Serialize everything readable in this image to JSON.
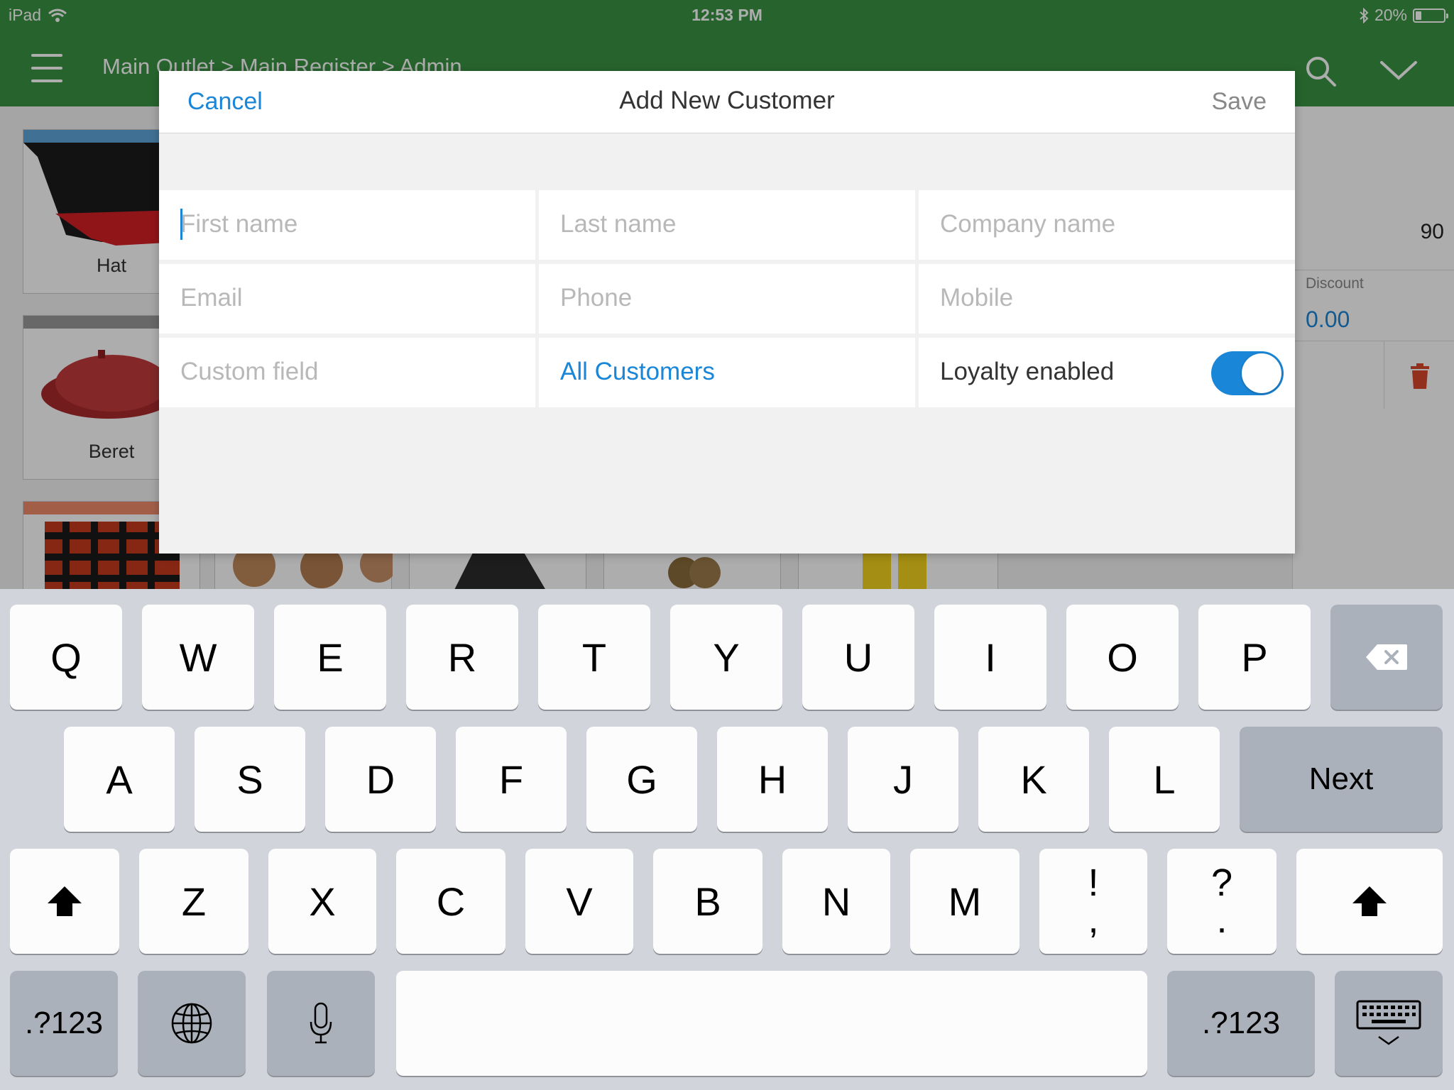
{
  "status_bar": {
    "device": "iPad",
    "time": "12:53 PM",
    "battery": "20%",
    "battery_fraction": 0.2
  },
  "app_bar": {
    "breadcrumb": "Main Outlet > Main Register > Admin"
  },
  "products": [
    "Hat",
    "Beret"
  ],
  "sale_panel": {
    "value": "90",
    "discount_label": "Discount",
    "discount_value": "0.00"
  },
  "modal": {
    "title": "Add New Customer",
    "cancel_label": "Cancel",
    "save_label": "Save",
    "fields": {
      "first_name": "First name",
      "last_name": "Last name",
      "company_name": "Company name",
      "email": "Email",
      "phone": "Phone",
      "mobile": "Mobile",
      "custom_field": "Custom field",
      "customer_group": "All Customers",
      "loyalty_label": "Loyalty enabled"
    },
    "loyalty_enabled": true
  },
  "keyboard": {
    "row1": [
      "Q",
      "W",
      "E",
      "R",
      "T",
      "Y",
      "U",
      "I",
      "O",
      "P"
    ],
    "row2": [
      "A",
      "S",
      "D",
      "F",
      "G",
      "H",
      "J",
      "K",
      "L"
    ],
    "row3": [
      "Z",
      "X",
      "C",
      "V",
      "B",
      "N",
      "M"
    ],
    "punct1": {
      "top": "!",
      "bottom": ","
    },
    "punct2": {
      "top": "?",
      "bottom": "."
    },
    "next_label": "Next",
    "numbers_label": ".?123",
    "colors": {
      "key": "#fcfcfc",
      "dark_key": "#abb1bb",
      "background": "#d1d5db"
    }
  },
  "colors": {
    "brand_green": "#3a9443",
    "accent_blue": "#1a86d8"
  }
}
